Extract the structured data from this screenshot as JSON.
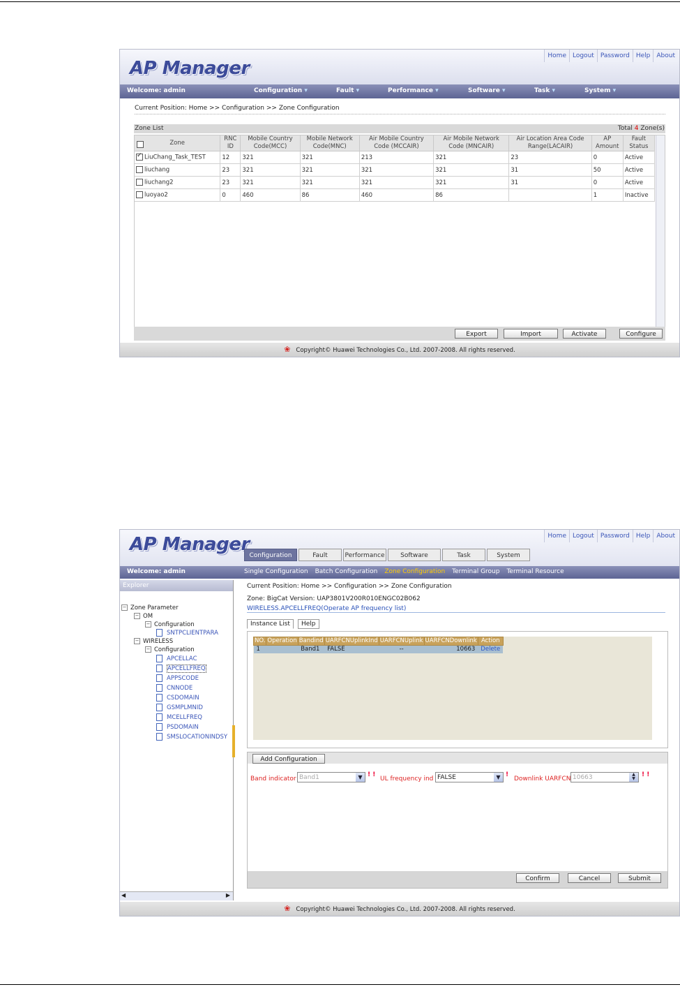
{
  "top": {
    "app_title": "AP Manager",
    "links": [
      "Home",
      "Logout",
      "Password",
      "Help",
      "About"
    ],
    "welcome": "Welcome: admin",
    "menus": [
      "Configuration",
      "Fault",
      "Performance",
      "Software",
      "Task",
      "System"
    ]
  },
  "zone_list_screen": {
    "breadcrumb": "Current Position: Home >> Configuration >> Zone Configuration",
    "panel_title": "Zone List",
    "total_prefix": "Total",
    "total_count": "4",
    "total_suffix": "Zone(s)",
    "columns": [
      "Zone",
      "RNC ID",
      "Mobile Country Code(MCC)",
      "Mobile Network Code(MNC)",
      "Air Mobile Country Code (MCCAIR)",
      "Air Mobile Network Code (MNCAIR)",
      "Air Location Area Code Range(LACAIR)",
      "AP Amount",
      "Fault Status"
    ],
    "rows": [
      {
        "checked": true,
        "cells": [
          "LiuChang_Task_TEST",
          "12",
          "321",
          "321",
          "213",
          "321",
          "23",
          "0",
          "Active"
        ]
      },
      {
        "checked": false,
        "cells": [
          "liuchang",
          "23",
          "321",
          "321",
          "321",
          "321",
          "31",
          "50",
          "Active"
        ]
      },
      {
        "checked": false,
        "cells": [
          "liuchang2",
          "23",
          "321",
          "321",
          "321",
          "321",
          "31",
          "0",
          "Active"
        ]
      },
      {
        "checked": false,
        "cells": [
          "luoyao2",
          "0",
          "460",
          "86",
          "460",
          "86",
          "",
          "1",
          "Inactive"
        ]
      }
    ],
    "buttons": {
      "export": "Export",
      "import": "Import",
      "activate": "Activate",
      "configure": "Configure"
    }
  },
  "footer": {
    "logo": "❀",
    "copyright": "Copyright© Huawei Technologies Co., Ltd. 2007-2008. All rights reserved."
  },
  "param_screen": {
    "tabs": [
      "Configuration",
      "Fault",
      "Performance",
      "Software",
      "Task",
      "System"
    ],
    "subnav": [
      "Single Configuration",
      "Batch Configuration",
      "Zone Configuration",
      "Terminal Group",
      "Terminal Resource"
    ],
    "explorer_title": "Explorer",
    "tree": {
      "root": "Zone Parameter",
      "om": "OM",
      "om_config": "Configuration",
      "om_items": [
        "SNTPCLIENTPARA"
      ],
      "wireless": "WIRELESS",
      "wireless_config": "Configuration",
      "wireless_items": [
        "APCELLAC",
        "APCELLFREQ",
        "APPSCODE",
        "CNNODE",
        "CSDOMAIN",
        "GSMPLMNID",
        "MCELLFREQ",
        "PSDOMAIN",
        "SMSLOCATIONINDSY"
      ]
    },
    "breadcrumb": "Current Position: Home >> Configuration >> Zone Configuration",
    "zone_line": "Zone: BigCat  Version: UAP3801V200R010ENGC02B062",
    "object_title": "WIRELESS.APCELLFREQ(Operate AP frequency list)",
    "subtabs": [
      "Instance List",
      "Help"
    ],
    "instance_columns": [
      "NO.",
      "Operation",
      "Bandind",
      "UARFCNUplinkInd",
      "UARFCNUplink",
      "UARFCNDownlink",
      "Action"
    ],
    "instance_rows": [
      [
        "1",
        "",
        "Band1",
        "FALSE",
        "--",
        "10663",
        "Delete"
      ]
    ],
    "add_button": "Add Configuration",
    "fields": {
      "band_label": "Band indicator",
      "band_value": "Band1",
      "ul_label": "UL frequency ind",
      "ul_value": "FALSE",
      "dl_label": "Downlink UARFCN",
      "dl_value": "10663"
    },
    "buttons": {
      "confirm": "Confirm",
      "cancel": "Cancel",
      "submit": "Submit"
    }
  }
}
